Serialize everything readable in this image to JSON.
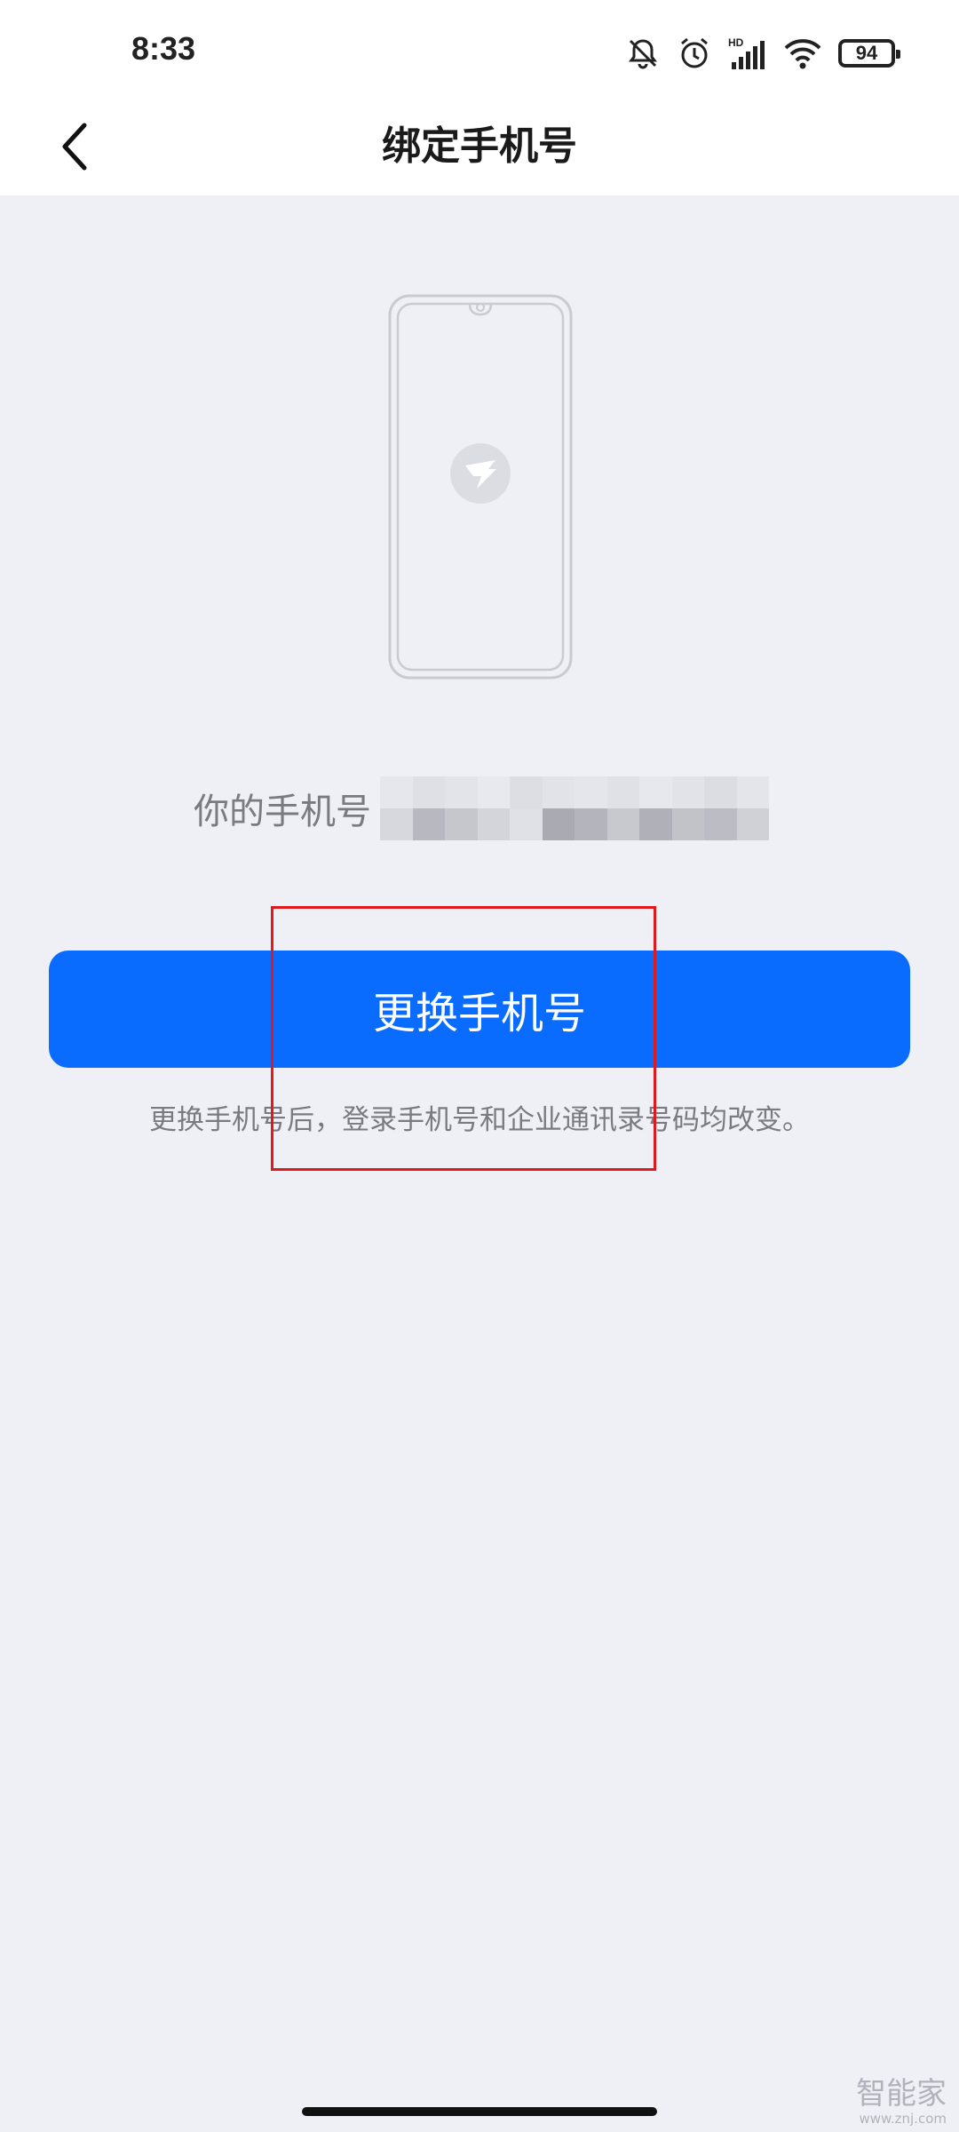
{
  "status_bar": {
    "time": "8:33",
    "icons": [
      "bell-off-icon",
      "alarm-icon",
      "hd-signal-icon",
      "wifi-icon"
    ],
    "battery": "94"
  },
  "nav": {
    "title": "绑定手机号",
    "back_icon": "chevron-left-icon"
  },
  "illustration": {
    "icon": "phone-app-logo-icon"
  },
  "phone_info": {
    "label": "你的手机号",
    "value_masked": true
  },
  "primary_button": {
    "label": "更换手机号"
  },
  "hint": "更换手机号后，登录手机号和企业通讯录号码均改变。",
  "watermark": {
    "main": "智能家",
    "sub": "www.znj.com"
  },
  "colors": {
    "accent": "#0a6cff",
    "background": "#eff0f5",
    "highlight": "#e0191e"
  }
}
